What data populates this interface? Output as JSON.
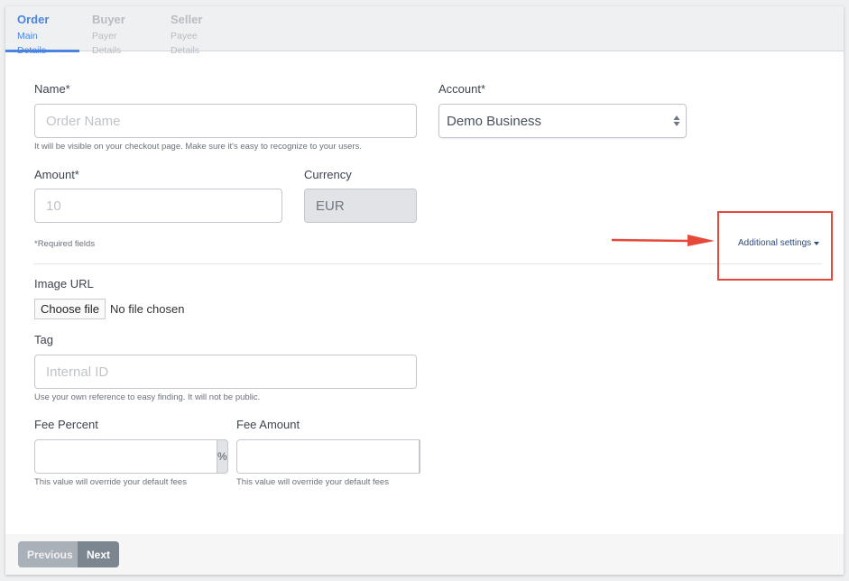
{
  "tabs": [
    {
      "title": "Order",
      "subtitle": "Main Details",
      "active": true
    },
    {
      "title": "Buyer",
      "subtitle": "Payer Details",
      "active": false
    },
    {
      "title": "Seller",
      "subtitle": "Payee Details",
      "active": false
    }
  ],
  "form": {
    "name": {
      "label": "Name*",
      "placeholder": "Order Name",
      "value": "",
      "help": "It will be visible on your checkout page. Make sure it's easy to recognize to your users."
    },
    "account": {
      "label": "Account*",
      "selected": "Demo Business"
    },
    "amount": {
      "label": "Amount*",
      "placeholder": "10",
      "value": ""
    },
    "currency": {
      "label": "Currency",
      "value": "EUR"
    },
    "required_note": "*Required fields",
    "additional_settings": "Additional settings",
    "image_url": {
      "label": "Image URL",
      "button": "Choose file",
      "status": "No file chosen"
    },
    "tag": {
      "label": "Tag",
      "placeholder": "Internal ID",
      "value": "",
      "help": "Use your own reference to easy finding. It will not be public."
    },
    "fee_percent": {
      "label": "Fee Percent",
      "value": "",
      "addon": "%",
      "help": "This value will override your default fees"
    },
    "fee_amount": {
      "label": "Fee Amount",
      "value": "",
      "addon": "",
      "help": "This value will override your default fees"
    }
  },
  "footer": {
    "previous": "Previous",
    "next": "Next"
  },
  "annotation": {
    "color": "#e5493a"
  },
  "colors": {
    "accent": "#4b84e0",
    "link": "#2c4a7a"
  }
}
